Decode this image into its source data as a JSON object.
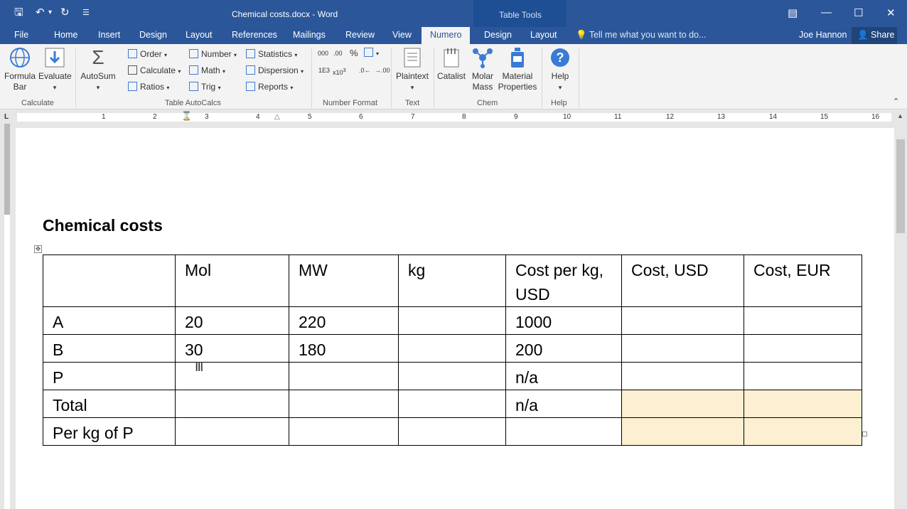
{
  "titlebar": {
    "doc_title": "Chemical costs.docx - Word",
    "contextual_group": "Table Tools"
  },
  "tabs": [
    "File",
    "Home",
    "Insert",
    "Design",
    "Layout",
    "References",
    "Mailings",
    "Review",
    "View",
    "Numero",
    "Design",
    "Layout"
  ],
  "active_tab": "Numero",
  "tellme_placeholder": "Tell me what you want to do...",
  "user_name": "Joe Hannon",
  "share_label": "Share",
  "ribbon": {
    "calculate": {
      "formula_bar_1": "Formula",
      "formula_bar_2": "Bar",
      "evaluate": "Evaluate",
      "label": "Calculate"
    },
    "autocalcs": {
      "autosum": "AutoSum",
      "order": "Order",
      "calculate": "Calculate",
      "ratios": "Ratios",
      "number": "Number",
      "math": "Math",
      "trig": "Trig",
      "statistics": "Statistics",
      "dispersion": "Dispersion",
      "reports": "Reports",
      "label": "Table AutoCalcs"
    },
    "number_format": {
      "label": "Number Format"
    },
    "text": {
      "plaintext": "Plaintext",
      "label": "Text"
    },
    "chem": {
      "catalist": "Catalist",
      "molar_1": "Molar",
      "molar_2": "Mass",
      "material_1": "Material",
      "material_2": "Properties",
      "label": "Chem"
    },
    "help": {
      "help": "Help",
      "label": "Help"
    }
  },
  "ruler_numbers": [
    "1",
    "2",
    "3",
    "4",
    "5",
    "6",
    "7",
    "8",
    "9",
    "10",
    "11",
    "12",
    "13",
    "14",
    "15",
    "16"
  ],
  "document": {
    "heading": "Chemical costs",
    "table": {
      "header": [
        "",
        "Mol",
        "MW",
        "kg",
        "Cost per kg, USD",
        "Cost, USD",
        "Cost, EUR"
      ],
      "rows": [
        [
          "A",
          "20",
          "220",
          "",
          "1000",
          "",
          ""
        ],
        [
          "B",
          "30",
          "180",
          "",
          "200",
          "",
          ""
        ],
        [
          "P",
          "",
          "",
          "",
          "n/a",
          "",
          ""
        ],
        [
          "Total",
          "",
          "",
          "",
          "n/a",
          "",
          ""
        ],
        [
          "Per kg of P",
          "",
          "",
          "",
          "",
          "",
          ""
        ]
      ]
    }
  },
  "colors": {
    "ribbon_blue": "#2b579a",
    "highlight_cell": "#fdf0d2"
  }
}
